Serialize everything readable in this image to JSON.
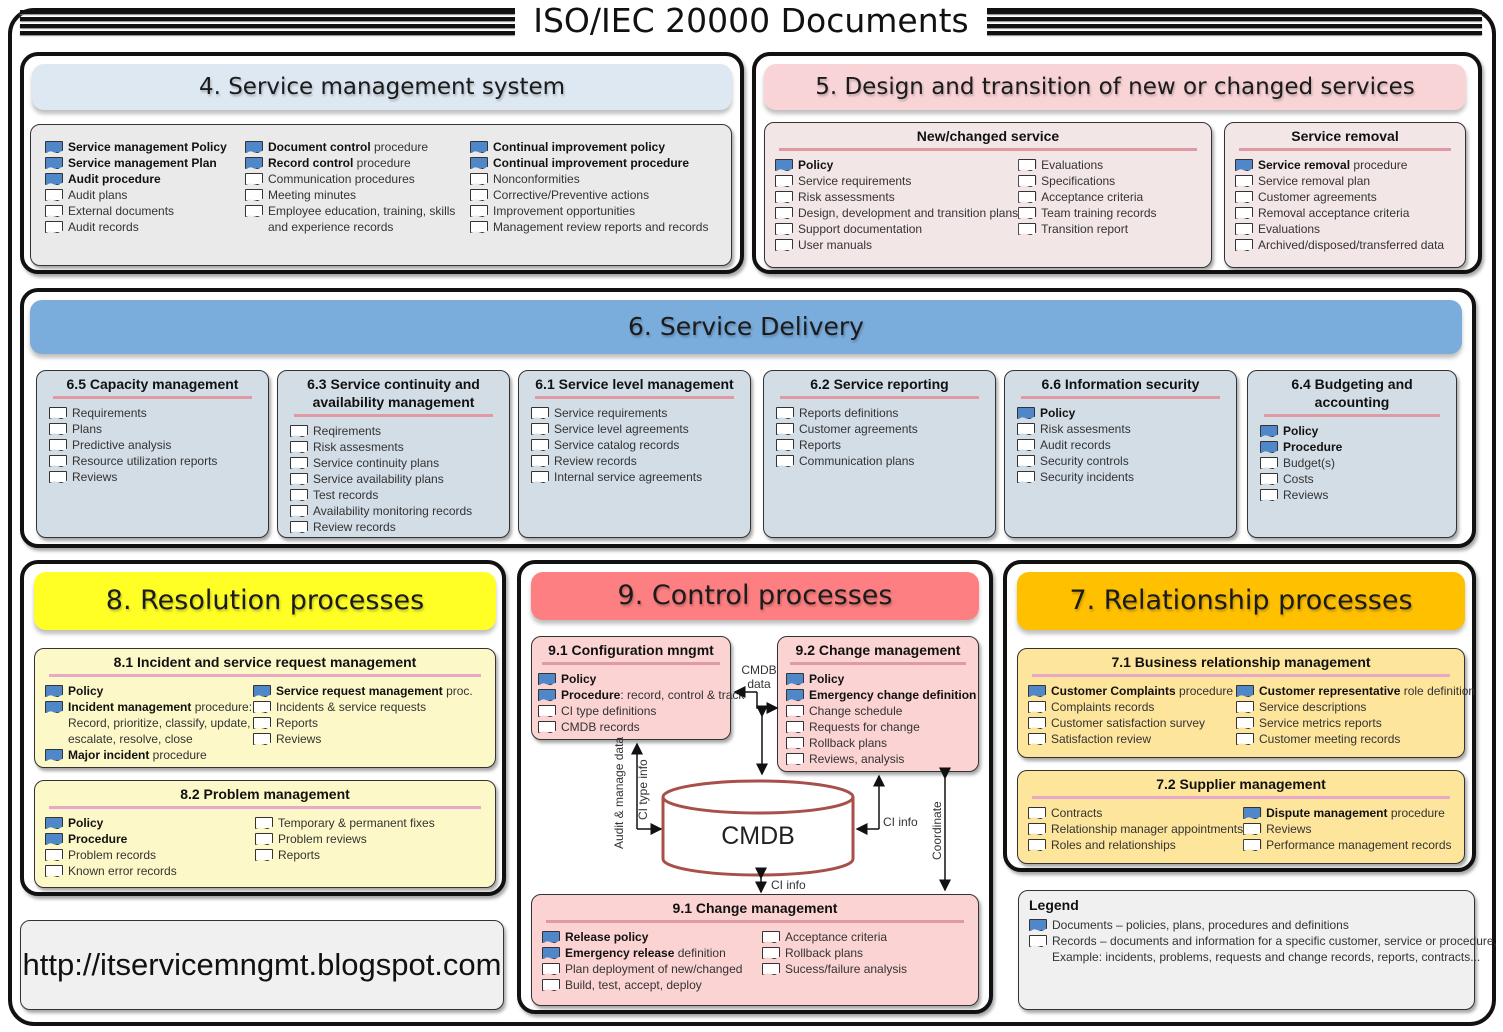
{
  "title": "ISO/IEC 20000 Documents",
  "colors": {
    "document_icon": "#4f87c8",
    "record_icon": "#ffffff",
    "sec4_banner": "#dde8f3",
    "sec5_banner": "#f9d4d6",
    "sec6_banner": "#7aacdc",
    "sec7_banner": "#ffc000",
    "sec8_banner": "#ffff26",
    "sec9_banner": "#fd7f81"
  },
  "sections": {
    "s4": {
      "title": "4. Service management system",
      "columns": [
        [
          {
            "type": "document",
            "bold": "Service management Policy",
            "rest": ""
          },
          {
            "type": "document",
            "bold": "Service management Plan",
            "rest": ""
          },
          {
            "type": "document",
            "bold": "Audit procedure",
            "rest": ""
          },
          {
            "type": "record",
            "bold": "",
            "rest": "Audit plans"
          },
          {
            "type": "record",
            "bold": "",
            "rest": "External documents"
          },
          {
            "type": "record",
            "bold": "",
            "rest": "Audit records"
          }
        ],
        [
          {
            "type": "document",
            "bold": "Document control",
            "rest": " procedure"
          },
          {
            "type": "document",
            "bold": "Record control",
            "rest": " procedure"
          },
          {
            "type": "record",
            "bold": "",
            "rest": "Communication procedures"
          },
          {
            "type": "record",
            "bold": "",
            "rest": "Meeting minutes"
          },
          {
            "type": "record",
            "bold": "",
            "rest": "Employee education, training, skills",
            "extra": "and experience records"
          }
        ],
        [
          {
            "type": "document",
            "bold": "Continual improvement policy",
            "rest": ""
          },
          {
            "type": "document",
            "bold": "Continual improvement procedure",
            "rest": ""
          },
          {
            "type": "record",
            "bold": "",
            "rest": "Nonconformities"
          },
          {
            "type": "record",
            "bold": "",
            "rest": "Corrective/Preventive actions"
          },
          {
            "type": "record",
            "bold": "",
            "rest": "Improvement opportunities"
          },
          {
            "type": "record",
            "bold": "",
            "rest": "Management review reports and records"
          }
        ]
      ]
    },
    "s5": {
      "title": "5. Design and transition of new or changed services",
      "new_changed": {
        "title": "New/changed service",
        "columns": [
          [
            {
              "type": "document",
              "bold": "Policy",
              "rest": ""
            },
            {
              "type": "record",
              "bold": "",
              "rest": "Service requirements"
            },
            {
              "type": "record",
              "bold": "",
              "rest": "Risk assessments"
            },
            {
              "type": "record",
              "bold": "",
              "rest": "Design, development and transition plans"
            },
            {
              "type": "record",
              "bold": "",
              "rest": "Support documentation"
            },
            {
              "type": "record",
              "bold": "",
              "rest": "User manuals"
            }
          ],
          [
            {
              "type": "record",
              "bold": "",
              "rest": "Evaluations"
            },
            {
              "type": "record",
              "bold": "",
              "rest": "Specifications"
            },
            {
              "type": "record",
              "bold": "",
              "rest": "Acceptance criteria"
            },
            {
              "type": "record",
              "bold": "",
              "rest": "Team training records"
            },
            {
              "type": "record",
              "bold": "",
              "rest": "Transition report"
            }
          ]
        ]
      },
      "removal": {
        "title": "Service removal",
        "items": [
          {
            "type": "document",
            "bold": "Service removal",
            "rest": " procedure"
          },
          {
            "type": "record",
            "bold": "",
            "rest": "Service removal plan"
          },
          {
            "type": "record",
            "bold": "",
            "rest": "Customer agreements"
          },
          {
            "type": "record",
            "bold": "",
            "rest": "Removal acceptance criteria"
          },
          {
            "type": "record",
            "bold": "",
            "rest": "Evaluations"
          },
          {
            "type": "record",
            "bold": "",
            "rest": "Archived/disposed/transferred data"
          }
        ]
      }
    },
    "s6": {
      "title": "6. Service Delivery",
      "boxes": [
        {
          "title": "6.5 Capacity management",
          "items": [
            {
              "type": "record",
              "bold": "",
              "rest": "Requirements"
            },
            {
              "type": "record",
              "bold": "",
              "rest": "Plans"
            },
            {
              "type": "record",
              "bold": "",
              "rest": "Predictive analysis"
            },
            {
              "type": "record",
              "bold": "",
              "rest": "Resource utilization reports"
            },
            {
              "type": "record",
              "bold": "",
              "rest": "Reviews"
            }
          ]
        },
        {
          "title": "6.3 Service continuity and availability management",
          "items": [
            {
              "type": "record",
              "bold": "",
              "rest": "Reqirements"
            },
            {
              "type": "record",
              "bold": "",
              "rest": "Risk assesments"
            },
            {
              "type": "record",
              "bold": "",
              "rest": "Service continuity plans"
            },
            {
              "type": "record",
              "bold": "",
              "rest": "Service availability plans"
            },
            {
              "type": "record",
              "bold": "",
              "rest": "Test records"
            },
            {
              "type": "record",
              "bold": "",
              "rest": "Availability monitoring records"
            },
            {
              "type": "record",
              "bold": "",
              "rest": "Review records"
            }
          ]
        },
        {
          "title": "6.1 Service level management",
          "items": [
            {
              "type": "record",
              "bold": "",
              "rest": "Service requirements"
            },
            {
              "type": "record",
              "bold": "",
              "rest": "Service level agreements"
            },
            {
              "type": "record",
              "bold": "",
              "rest": "Service catalog records"
            },
            {
              "type": "record",
              "bold": "",
              "rest": "Review records"
            },
            {
              "type": "record",
              "bold": "",
              "rest": "Internal service agreements"
            }
          ]
        },
        {
          "title": "6.2 Service reporting",
          "items": [
            {
              "type": "record",
              "bold": "",
              "rest": "Reports definitions"
            },
            {
              "type": "record",
              "bold": "",
              "rest": "Customer agreements"
            },
            {
              "type": "record",
              "bold": "",
              "rest": "Reports"
            },
            {
              "type": "record",
              "bold": "",
              "rest": "Communication plans"
            }
          ]
        },
        {
          "title": "6.6 Information security",
          "items": [
            {
              "type": "document",
              "bold": "Policy",
              "rest": ""
            },
            {
              "type": "record",
              "bold": "",
              "rest": "Risk assesments"
            },
            {
              "type": "record",
              "bold": "",
              "rest": "Audit records"
            },
            {
              "type": "record",
              "bold": "",
              "rest": "Security controls"
            },
            {
              "type": "record",
              "bold": "",
              "rest": "Security incidents"
            }
          ]
        },
        {
          "title": "6.4 Budgeting and accounting",
          "items": [
            {
              "type": "document",
              "bold": "Policy",
              "rest": ""
            },
            {
              "type": "document",
              "bold": "Procedure",
              "rest": ""
            },
            {
              "type": "record",
              "bold": "",
              "rest": "Budget(s)"
            },
            {
              "type": "record",
              "bold": "",
              "rest": "Costs"
            },
            {
              "type": "record",
              "bold": "",
              "rest": "Reviews"
            }
          ]
        }
      ]
    },
    "s8": {
      "title": "8. Resolution processes",
      "incident": {
        "title": "8.1 Incident and service request management",
        "columns": [
          [
            {
              "type": "document",
              "bold": "Policy",
              "rest": ""
            },
            {
              "type": "document",
              "bold": "Incident management",
              "rest": " procedure:",
              "extra": "Record, prioritize, classify, update,",
              "extra2": "escalate, resolve, close"
            },
            {
              "type": "document",
              "bold": "Major incident",
              "rest": " procedure"
            }
          ],
          [
            {
              "type": "document",
              "bold": "Service request management",
              "rest": " proc."
            },
            {
              "type": "record",
              "bold": "",
              "rest": "Incidents & service requests"
            },
            {
              "type": "record",
              "bold": "",
              "rest": "Reports"
            },
            {
              "type": "record",
              "bold": "",
              "rest": "Reviews"
            }
          ]
        ]
      },
      "problem": {
        "title": "8.2 Problem management",
        "columns": [
          [
            {
              "type": "document",
              "bold": "Policy",
              "rest": ""
            },
            {
              "type": "document",
              "bold": "Procedure",
              "rest": ""
            },
            {
              "type": "record",
              "bold": "",
              "rest": "Problem records"
            },
            {
              "type": "record",
              "bold": "",
              "rest": "Known error records"
            }
          ],
          [
            {
              "type": "record",
              "bold": "",
              "rest": "Temporary & permanent fixes"
            },
            {
              "type": "record",
              "bold": "",
              "rest": "Problem reviews"
            },
            {
              "type": "record",
              "bold": "",
              "rest": "Reports"
            }
          ]
        ]
      }
    },
    "s9": {
      "title": "9. Control processes",
      "config": {
        "title": "9.1 Configuration mngmt",
        "items": [
          {
            "type": "document",
            "bold": "Policy",
            "rest": ""
          },
          {
            "type": "document",
            "bold": "Procedure",
            "rest": ": record, control & track"
          },
          {
            "type": "record",
            "bold": "",
            "rest": "CI type definitions"
          },
          {
            "type": "record",
            "bold": "",
            "rest": "CMDB records"
          }
        ]
      },
      "change": {
        "title": "9.2 Change management",
        "items": [
          {
            "type": "document",
            "bold": "Policy",
            "rest": ""
          },
          {
            "type": "document",
            "bold": "Emergency change definition",
            "rest": ""
          },
          {
            "type": "record",
            "bold": "",
            "rest": "Change schedule"
          },
          {
            "type": "record",
            "bold": "",
            "rest": "Requests for change"
          },
          {
            "type": "record",
            "bold": "",
            "rest": "Rollback plans"
          },
          {
            "type": "record",
            "bold": "",
            "rest": "Reviews, analysis"
          }
        ]
      },
      "release": {
        "title": "9.1 Change management",
        "columns": [
          [
            {
              "type": "document",
              "bold": "Release policy",
              "rest": ""
            },
            {
              "type": "document",
              "bold": "Emergency release",
              "rest": " definition"
            },
            {
              "type": "record",
              "bold": "",
              "rest": "Plan deployment of new/changed"
            },
            {
              "type": "record",
              "bold": "",
              "rest": "Build, test, accept, deploy"
            }
          ],
          [
            {
              "type": "record",
              "bold": "",
              "rest": "Acceptance criteria"
            },
            {
              "type": "record",
              "bold": "",
              "rest": "Rollback plans"
            },
            {
              "type": "record",
              "bold": "",
              "rest": "Sucess/failure analysis"
            }
          ]
        ]
      },
      "cmdb_label": "CMDB",
      "labels": {
        "cmdb_data_1": "CMDB",
        "cmdb_data_2": "data",
        "audit_manage": "Audit & manage data",
        "ci_type_info": "CI type info",
        "ci_info_right": "CI info",
        "ci_info_bottom": "CI info",
        "coordinate": "Coordinate"
      }
    },
    "s7": {
      "title": "7. Relationship processes",
      "business": {
        "title": "7.1 Business relationship management",
        "columns": [
          [
            {
              "type": "document",
              "bold": "Customer Complaints",
              "rest": " procedure"
            },
            {
              "type": "record",
              "bold": "",
              "rest": "Complaints records"
            },
            {
              "type": "record",
              "bold": "",
              "rest": "Customer satisfaction survey"
            },
            {
              "type": "record",
              "bold": "",
              "rest": "Satisfaction review"
            }
          ],
          [
            {
              "type": "document",
              "bold": "Customer representative",
              "rest": " role definition"
            },
            {
              "type": "record",
              "bold": "",
              "rest": "Service descriptions"
            },
            {
              "type": "record",
              "bold": "",
              "rest": "Service metrics reports"
            },
            {
              "type": "record",
              "bold": "",
              "rest": "Customer meeting records"
            }
          ]
        ]
      },
      "supplier": {
        "title": "7.2 Supplier management",
        "columns": [
          [
            {
              "type": "record",
              "bold": "",
              "rest": "Contracts"
            },
            {
              "type": "record",
              "bold": "",
              "rest": "Relationship manager appointments"
            },
            {
              "type": "record",
              "bold": "",
              "rest": "Roles and relationships"
            }
          ],
          [
            {
              "type": "document",
              "bold": "Dispute management",
              "rest": " procedure"
            },
            {
              "type": "record",
              "bold": "",
              "rest": "Reviews"
            },
            {
              "type": "record",
              "bold": "",
              "rest": "Performance management records"
            }
          ]
        ]
      }
    }
  },
  "legend": {
    "title": "Legend",
    "items": [
      {
        "type": "document",
        "text": "Documents – policies, plans, procedures and definitions"
      },
      {
        "type": "record",
        "text": "Records – documents and information for a specific customer, service or procedure,",
        "extra": "Example: incidents, problems, requests and change records, reports, contracts..."
      }
    ]
  },
  "footer_url": "http://itservicemngmt.blogspot.com"
}
